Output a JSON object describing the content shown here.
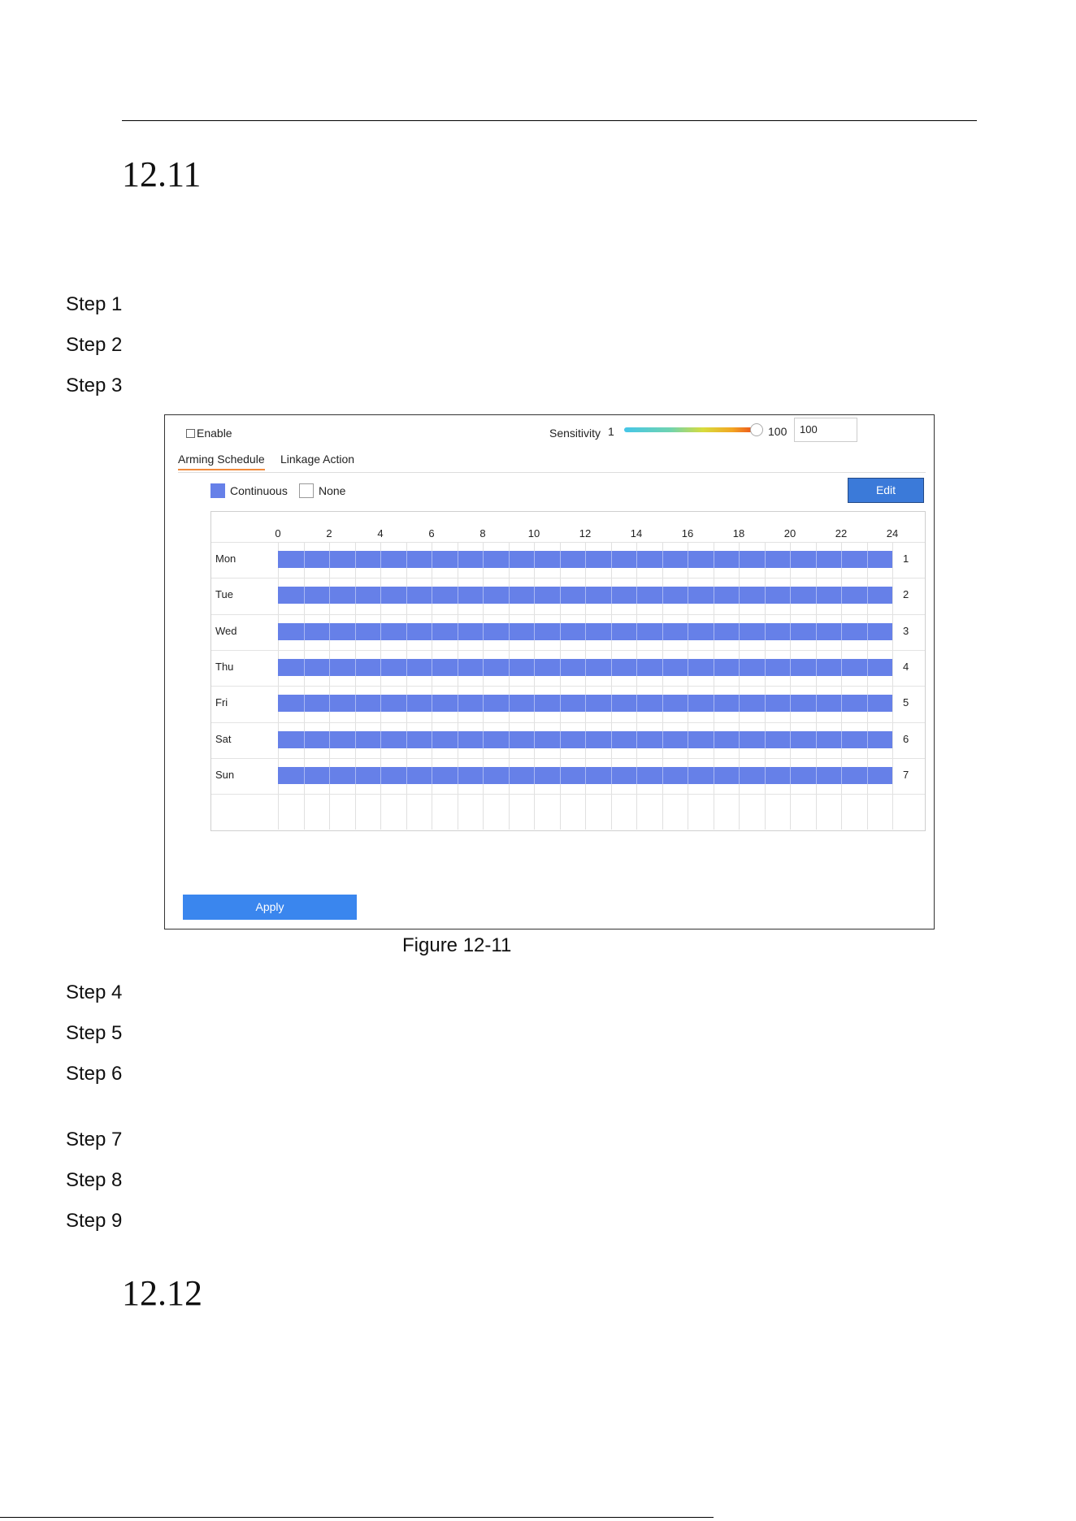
{
  "sections": [
    {
      "number": "12.11"
    },
    {
      "number": "12.12"
    }
  ],
  "steps": [
    "Step 1",
    "Step 2",
    "Step 3",
    "Step 4",
    "Step 5",
    "Step 6",
    "Step 7",
    "Step 8",
    "Step 9"
  ],
  "figure": {
    "caption": "Figure 12-11",
    "enable_label": "Enable",
    "enable_checked": false,
    "sensitivity": {
      "label": "Sensitivity",
      "min_label": "1",
      "max_label": "100",
      "value": "100",
      "level": 1.0
    },
    "tabs": [
      {
        "label": "Arming Schedule",
        "active": true
      },
      {
        "label": "Linkage Action",
        "active": false
      }
    ],
    "legend": [
      {
        "label": "Continuous",
        "color": "#6680e8"
      },
      {
        "label": "None",
        "color": "#ffffff"
      }
    ],
    "edit_label": "Edit",
    "apply_label": "Apply",
    "hours": [
      "0",
      "2",
      "4",
      "6",
      "8",
      "10",
      "12",
      "14",
      "16",
      "18",
      "20",
      "22",
      "24"
    ],
    "days": [
      {
        "name": "Mon",
        "index": "1",
        "start": 0,
        "end": 24
      },
      {
        "name": "Tue",
        "index": "2",
        "start": 0,
        "end": 24
      },
      {
        "name": "Wed",
        "index": "3",
        "start": 0,
        "end": 24
      },
      {
        "name": "Thu",
        "index": "4",
        "start": 0,
        "end": 24
      },
      {
        "name": "Fri",
        "index": "5",
        "start": 0,
        "end": 24
      },
      {
        "name": "Sat",
        "index": "6",
        "start": 0,
        "end": 24
      },
      {
        "name": "Sun",
        "index": "7",
        "start": 0,
        "end": 24
      }
    ]
  }
}
